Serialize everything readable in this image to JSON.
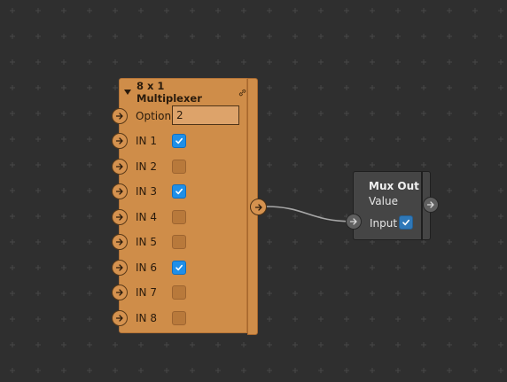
{
  "multiplexer": {
    "title": "8 x 1 Multiplexer",
    "option": {
      "label": "Option",
      "value": "2"
    },
    "inputs": [
      {
        "label": "IN 1",
        "checked": true
      },
      {
        "label": "IN 2",
        "checked": false
      },
      {
        "label": "IN 3",
        "checked": true
      },
      {
        "label": "IN 4",
        "checked": false
      },
      {
        "label": "IN 5",
        "checked": false
      },
      {
        "label": "IN 6",
        "checked": true
      },
      {
        "label": "IN 7",
        "checked": false
      },
      {
        "label": "IN 8",
        "checked": false
      }
    ]
  },
  "mux_out": {
    "title": "Mux Out",
    "subtitle": "Value",
    "input_label": "Input",
    "input_checked": true
  },
  "colors": {
    "background": "#2f2f2f",
    "node_orange": "#cf8d49",
    "node_gray": "#454545",
    "checkbox_blue": "#1f8fe8"
  },
  "icons": {
    "pin": "arrow-right-icon",
    "header": "collapse-triangle-icon",
    "link": "link-icon",
    "check": "checkmark-icon"
  }
}
